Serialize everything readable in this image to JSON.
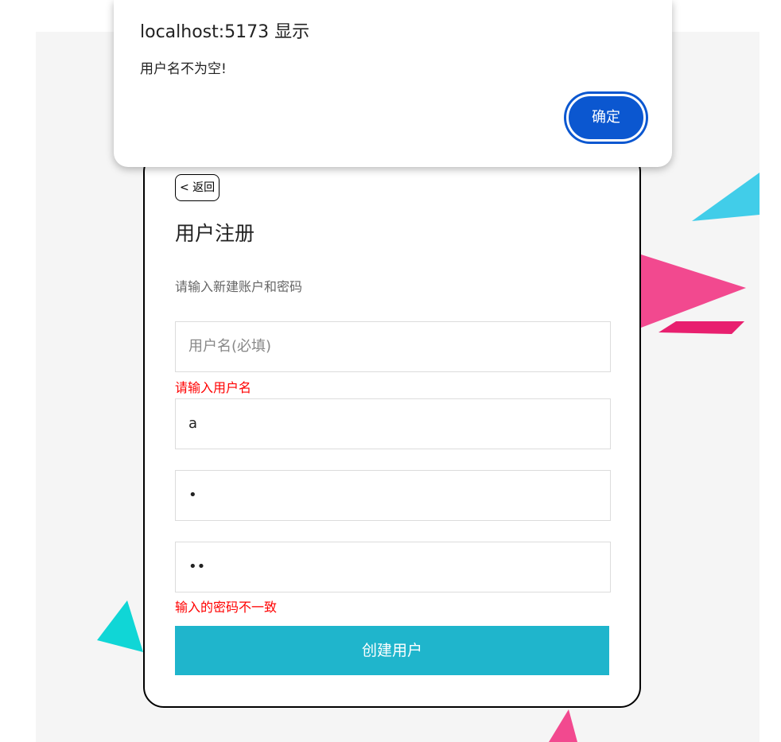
{
  "dialog": {
    "title": "localhost:5173 显示",
    "message": "用户名不为空!",
    "ok_label": "确定"
  },
  "register": {
    "back_label": "< 返回",
    "title": "用户注册",
    "subtitle": "请输入新建账户和密码",
    "username": {
      "placeholder": "用户名(必填)",
      "value": ""
    },
    "username_error": "请输入用户名",
    "nickname": {
      "value": "a"
    },
    "password": {
      "value": "•"
    },
    "confirm_password": {
      "value": "••"
    },
    "password_error": "输入的密码不一致",
    "submit_label": "创建用户"
  },
  "colors": {
    "accent": "#1fb5cc",
    "error": "#ff0000",
    "dialog_button": "#0b57d0",
    "background": "#f5f5f5"
  }
}
